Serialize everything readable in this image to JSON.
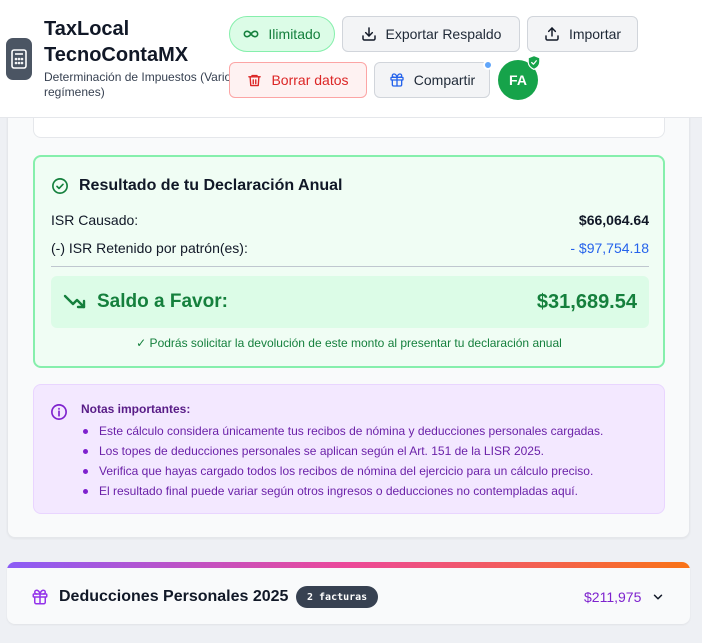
{
  "header": {
    "title": "TaxLocal TecnoContaMX",
    "subtitle": "Determinación de Impuestos (Varios regímenes)",
    "plan_label": "Ilimitado",
    "export_label": "Exportar Respaldo",
    "import_label": "Importar",
    "delete_label": "Borrar datos",
    "share_label": "Compartir",
    "avatar_initials": "FA"
  },
  "result": {
    "title": "Resultado de tu Declaración Anual",
    "isr_causado_label": "ISR Causado:",
    "isr_causado_value": "$66,064.64",
    "isr_retenido_label": "(-) ISR Retenido por patrón(es):",
    "isr_retenido_value": "- $97,754.18",
    "saldo_label": "Saldo a Favor:",
    "saldo_value": "$31,689.54",
    "note": "✓ Podrás solicitar la devolución de este monto al presentar tu declaración anual"
  },
  "notes": {
    "title": "Notas importantes:",
    "items": [
      "Este cálculo considera únicamente tus recibos de nómina y deducciones personales cargadas.",
      "Los topes de deducciones personales se aplican según el Art. 151 de la LISR 2025.",
      "Verifica que hayas cargado todos los recibos de nómina del ejercicio para un cálculo preciso.",
      "El resultado final puede variar según otros ingresos o deducciones no contempladas aquí."
    ]
  },
  "deducciones": {
    "title": "Deducciones Personales 2025",
    "badge": "2 facturas",
    "amount": "$211,975"
  },
  "colors": {
    "success": "#15803d",
    "danger": "#dc2626",
    "accent_purple": "#7e22ce",
    "link_blue": "#2563eb"
  }
}
